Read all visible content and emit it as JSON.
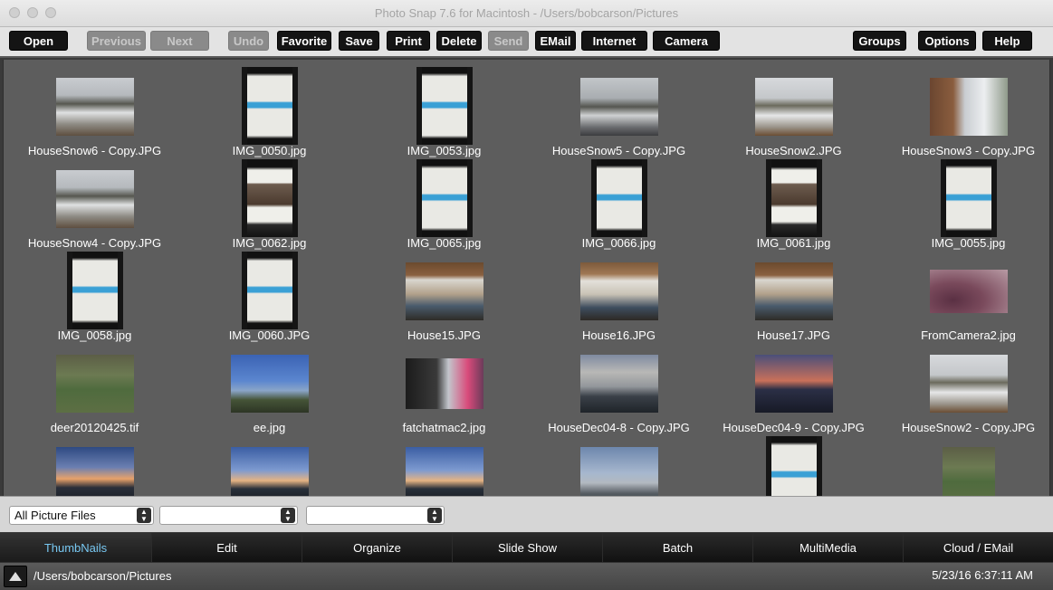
{
  "window": {
    "title": "Photo Snap 7.6 for Macintosh - /Users/bobcarson/Pictures"
  },
  "toolbar": {
    "buttons": [
      {
        "label": "Open",
        "enabled": true
      },
      {
        "label": "Previous",
        "enabled": false
      },
      {
        "label": "Next",
        "enabled": false
      },
      {
        "label": "Undo",
        "enabled": false
      },
      {
        "label": "Favorite",
        "enabled": true
      },
      {
        "label": "Save",
        "enabled": true
      },
      {
        "label": "Print",
        "enabled": true
      },
      {
        "label": "Delete",
        "enabled": true
      },
      {
        "label": "Send",
        "enabled": false
      },
      {
        "label": "EMail",
        "enabled": true
      },
      {
        "label": "Internet",
        "enabled": true
      },
      {
        "label": "Camera",
        "enabled": true
      },
      {
        "label": "Groups",
        "enabled": true
      },
      {
        "label": "Options",
        "enabled": true
      },
      {
        "label": "Help",
        "enabled": true
      }
    ]
  },
  "thumbnails": [
    {
      "name": "HouseSnow6 - Copy.JPG"
    },
    {
      "name": "IMG_0050.jpg"
    },
    {
      "name": "IMG_0053.jpg"
    },
    {
      "name": "HouseSnow5 - Copy.JPG"
    },
    {
      "name": "HouseSnow2.JPG"
    },
    {
      "name": "HouseSnow3 - Copy.JPG"
    },
    {
      "name": "HouseSnow4 - Copy.JPG"
    },
    {
      "name": "IMG_0062.jpg"
    },
    {
      "name": "IMG_0065.jpg"
    },
    {
      "name": "IMG_0066.jpg"
    },
    {
      "name": "IMG_0061.jpg"
    },
    {
      "name": "IMG_0055.jpg"
    },
    {
      "name": "IMG_0058.jpg"
    },
    {
      "name": "IMG_0060.JPG"
    },
    {
      "name": "House15.JPG"
    },
    {
      "name": "House16.JPG"
    },
    {
      "name": "House17.JPG"
    },
    {
      "name": "FromCamera2.jpg"
    },
    {
      "name": "deer20120425.tif"
    },
    {
      "name": "ee.jpg"
    },
    {
      "name": "fatchatmac2.jpg"
    },
    {
      "name": "HouseDec04-8 - Copy.JPG"
    },
    {
      "name": "HouseDec04-9 - Copy.JPG"
    },
    {
      "name": "HouseSnow2 - Copy.JPG"
    }
  ],
  "filters": {
    "file_type": "All Picture Files",
    "filter2": "",
    "filter3": ""
  },
  "tabs": [
    {
      "label": "ThumbNails",
      "active": true
    },
    {
      "label": "Edit",
      "active": false
    },
    {
      "label": "Organize",
      "active": false
    },
    {
      "label": "Slide Show",
      "active": false
    },
    {
      "label": "Batch",
      "active": false
    },
    {
      "label": "MultiMedia",
      "active": false
    },
    {
      "label": "Cloud / EMail",
      "active": false
    }
  ],
  "status": {
    "path": "/Users/bobcarson/Pictures",
    "datetime": "5/23/16 6:37:11 AM"
  }
}
